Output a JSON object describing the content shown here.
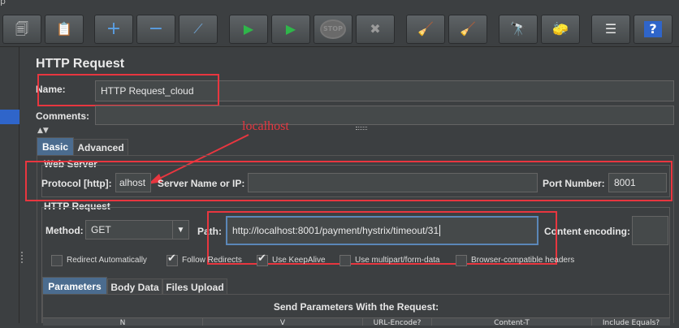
{
  "window": {
    "title_fragment": "p"
  },
  "toolbar": {
    "buttons": [
      {
        "name": "templates",
        "glyph": "🗐"
      },
      {
        "name": "clipboard",
        "glyph": "📋"
      },
      {
        "name": "expand",
        "glyph": "+"
      },
      {
        "name": "collapse",
        "glyph": "−"
      },
      {
        "name": "toggle",
        "glyph": "⟋"
      },
      {
        "name": "start",
        "glyph": "▶"
      },
      {
        "name": "start-no-pause",
        "glyph": "▶"
      },
      {
        "name": "stop",
        "glyph": "STOP"
      },
      {
        "name": "shutdown",
        "glyph": "✖"
      },
      {
        "name": "clear",
        "glyph": "🧹"
      },
      {
        "name": "clear-all",
        "glyph": "🧹"
      },
      {
        "name": "search",
        "glyph": "🔭"
      },
      {
        "name": "reset-search",
        "glyph": "🧽"
      },
      {
        "name": "function-helper",
        "glyph": "☰"
      },
      {
        "name": "help",
        "glyph": "?"
      }
    ]
  },
  "panel": {
    "title": "HTTP Request",
    "name_label": "Name:",
    "name_value": "HTTP Request_cloud",
    "comments_label": "Comments:",
    "comments_value": "",
    "tabs": [
      "Basic",
      "Advanced"
    ],
    "annotation": "localhost"
  },
  "web_server": {
    "title": "Web Server",
    "protocol_label": "Protocol [http]:",
    "protocol_value": "alhost",
    "server_label": "Server Name or IP:",
    "server_value": "",
    "port_label": "Port Number:",
    "port_value": "8001"
  },
  "http_request": {
    "title": "HTTP Request",
    "method_label": "Method:",
    "method_value": "GET",
    "path_label": "Path:",
    "path_value": "http://localhost:8001/payment/hystrix/timeout/31",
    "encoding_label": "Content encoding:",
    "encoding_value": "",
    "options": [
      {
        "label": "Redirect Automatically",
        "checked": false
      },
      {
        "label": "Follow Redirects",
        "checked": true
      },
      {
        "label": "Use KeepAlive",
        "checked": true
      },
      {
        "label": "Use multipart/form-data",
        "checked": false
      },
      {
        "label": "Browser-compatible headers",
        "checked": false
      }
    ],
    "subtabs": [
      "Parameters",
      "Body Data",
      "Files Upload"
    ],
    "params_caption": "Send Parameters With the Request:",
    "columns": [
      "N",
      "V",
      "URL-Encode?",
      "Content-T",
      "Include Equals?"
    ]
  },
  "colors": {
    "accent": "#e8363f",
    "selection": "#4b6c8f"
  }
}
